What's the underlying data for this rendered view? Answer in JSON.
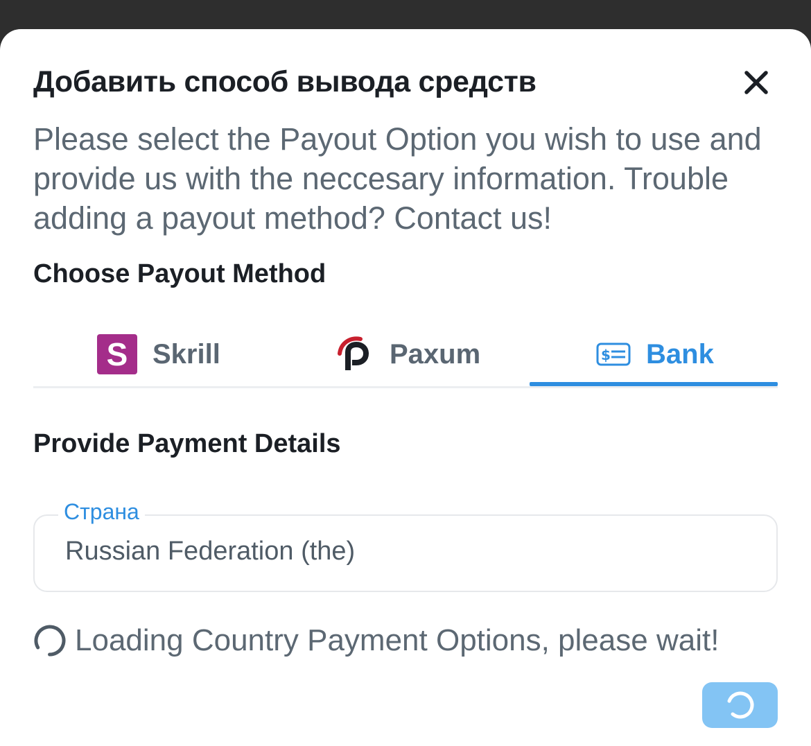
{
  "dialog": {
    "title": "Добавить способ вывода средств",
    "close_icon": "close-icon",
    "description": "Please select the Payout Option you wish to use and provide us with the neccesary information. Trouble adding a payout method? Contact us!"
  },
  "payout_methods": {
    "heading": "Choose Payout Method",
    "tabs": [
      {
        "label": "Skrill",
        "icon": "skrill-logo",
        "logo_letter": "S",
        "active": false
      },
      {
        "label": "Paxum",
        "icon": "paxum-logo",
        "active": false
      },
      {
        "label": "Bank",
        "icon": "bank-check-icon",
        "active": true
      }
    ]
  },
  "payment_details": {
    "heading": "Provide Payment Details",
    "country_field": {
      "label": "Страна",
      "value": "Russian Federation (the)"
    },
    "loading_text": "Loading Country Payment Options, please wait!"
  },
  "submit_button": {
    "state": "loading",
    "icon": "spinner-icon"
  },
  "colors": {
    "accent": "#2e8ee0",
    "button_disabled": "#83c4f4",
    "skrill": "#a42d8a",
    "paxum_red": "#c8202e",
    "text_dark": "#1b1f25",
    "text_muted": "#5c6873"
  }
}
